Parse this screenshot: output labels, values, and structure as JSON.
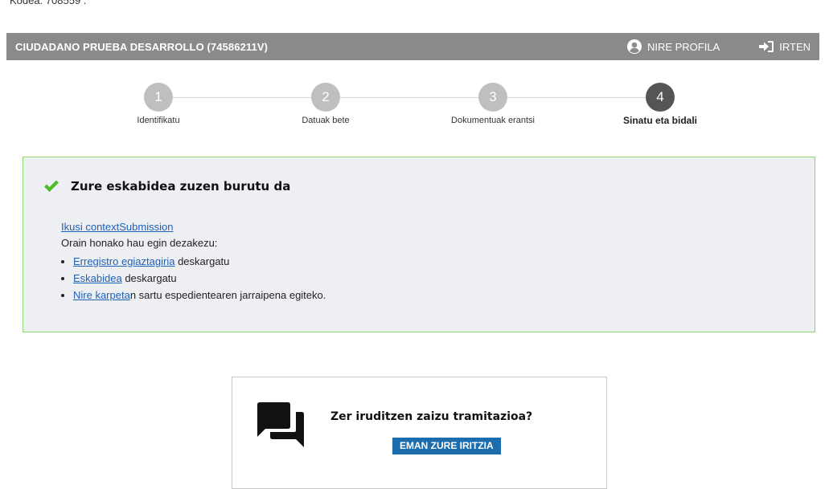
{
  "page_top_cut_text": "Kodea: 708559 .",
  "header": {
    "user_name": "CIUDADANO PRUEBA DESARROLLO (74586211V)",
    "profile_label": "NIRE PROFILA",
    "profile_icon": "user-circle-icon",
    "exit_label": "IRTEN",
    "exit_icon": "sign-in-arrow-icon",
    "background_color": "#8a8a8a"
  },
  "stepper": {
    "steps": [
      {
        "number": "1",
        "label": "Identifikatu",
        "active": false
      },
      {
        "number": "2",
        "label": "Datuak bete",
        "active": false
      },
      {
        "number": "3",
        "label": "Dokumentuak erantsi",
        "active": false
      },
      {
        "number": "4",
        "label": "Sinatu eta bidali",
        "active": true
      }
    ],
    "inactive_color": "#bfbfbf",
    "active_color": "#555555"
  },
  "success": {
    "icon": "checkmark-icon",
    "title": "Zure eskabidea zuzen burutu da",
    "view_link": "Ikusi contextSubmission",
    "intro": "Orain honako hau egin dezakezu:",
    "items": [
      {
        "link": "Erregistro egiaztagiria",
        "rest": " deskargatu"
      },
      {
        "link": "Eskabidea",
        "rest": " deskargatu"
      },
      {
        "link": "Nire karpeta",
        "rest": "n sartu espedientearen jarraipena egiteko."
      }
    ],
    "border_color": "#8fd672",
    "check_color": "#4cbd2c",
    "background_color": "#eeeff3"
  },
  "feedback": {
    "icon": "chat-bubbles-icon",
    "question": "Zer iruditzen zaizu tramitazioa?",
    "button_label": "EMAN ZURE IRITZIA",
    "button_color": "#1b6dae"
  }
}
